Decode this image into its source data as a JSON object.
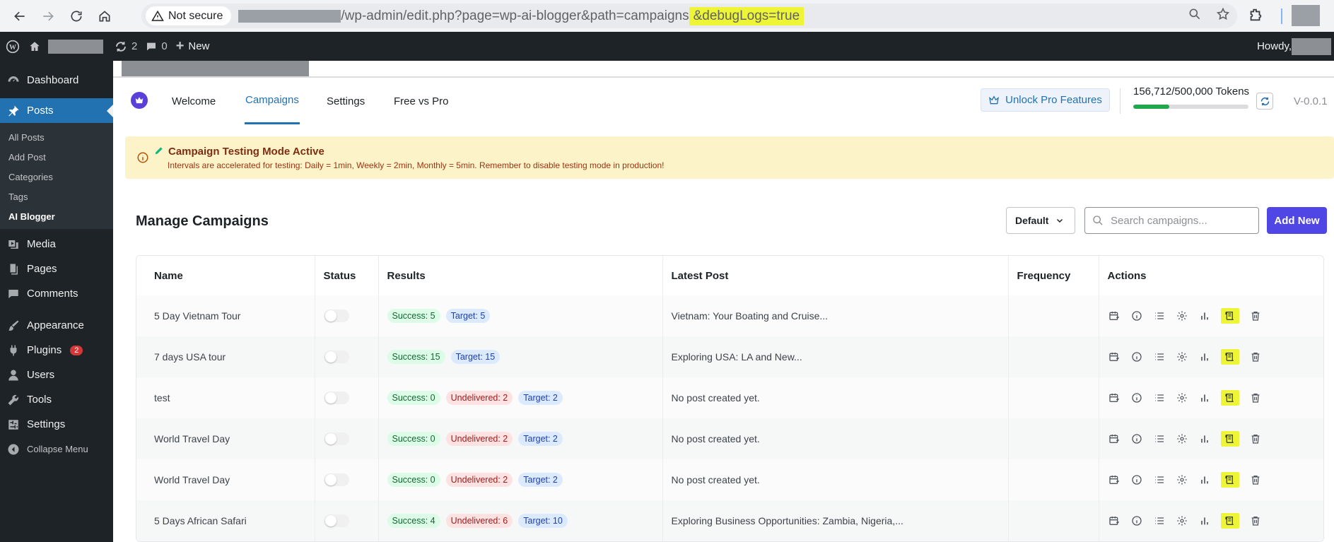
{
  "browser": {
    "security_label": "Not secure",
    "url_path": "/wp-admin/edit.php?page=wp-ai-blogger&path=campaigns",
    "url_highlight": "&debugLogs=true"
  },
  "adminbar": {
    "updates_count": "2",
    "comments_count": "0",
    "new_label": "New",
    "howdy": "Howdy,"
  },
  "sidebar": {
    "dashboard": "Dashboard",
    "posts": "Posts",
    "submenu": [
      "All Posts",
      "Add Post",
      "Categories",
      "Tags",
      "AI Blogger"
    ],
    "media": "Media",
    "pages": "Pages",
    "comments": "Comments",
    "appearance": "Appearance",
    "plugins": "Plugins",
    "plugins_badge": "2",
    "users": "Users",
    "tools": "Tools",
    "settings": "Settings",
    "collapse": "Collapse Menu"
  },
  "header": {
    "tabs": [
      "Welcome",
      "Campaigns",
      "Settings",
      "Free vs Pro"
    ],
    "unlock_label": "Unlock Pro Features",
    "tokens_label": "156,712/500,000 Tokens",
    "tokens_fraction": 0.313,
    "version": "V-0.0.1"
  },
  "notice": {
    "title": "Campaign Testing Mode Active",
    "text": "Intervals are accelerated for testing: Daily = 1min, Weekly = 2min, Monthly = 5min. Remember to disable testing mode in production!"
  },
  "campaigns": {
    "title": "Manage Campaigns",
    "sort_value": "Default",
    "search_placeholder": "Search campaigns...",
    "add_label": "Add New",
    "columns": [
      "Name",
      "Status",
      "Results",
      "Latest Post",
      "Frequency",
      "Actions"
    ],
    "rows": [
      {
        "name": "5 Day Vietnam Tour",
        "success": "Success: 5",
        "undelivered": "",
        "target": "Target: 5",
        "latest": "Vietnam: Your Boating and Cruise...",
        "frequency": ""
      },
      {
        "name": "7 days USA tour",
        "success": "Success: 15",
        "undelivered": "",
        "target": "Target: 15",
        "latest": "Exploring USA: LA and New...",
        "frequency": ""
      },
      {
        "name": "test",
        "success": "Success: 0",
        "undelivered": "Undelivered: 2",
        "target": "Target: 2",
        "latest": "No post created yet.",
        "frequency": ""
      },
      {
        "name": "World Travel Day",
        "success": "Success: 0",
        "undelivered": "Undelivered: 2",
        "target": "Target: 2",
        "latest": "No post created yet.",
        "frequency": ""
      },
      {
        "name": "World Travel Day",
        "success": "Success: 0",
        "undelivered": "Undelivered: 2",
        "target": "Target: 2",
        "latest": "No post created yet.",
        "frequency": ""
      },
      {
        "name": "5 Days African Safari",
        "success": "Success: 4",
        "undelivered": "Undelivered: 6",
        "target": "Target: 10",
        "latest": "Exploring Business Opportunities: Zambia, Nigeria,...",
        "frequency": ""
      }
    ]
  },
  "colors": {
    "wp_blue": "#2271b1",
    "admin_dark": "#1d2327",
    "accent_purple": "#4f46e5",
    "highlight_yellow": "#eef536",
    "token_green": "#21a84c"
  }
}
